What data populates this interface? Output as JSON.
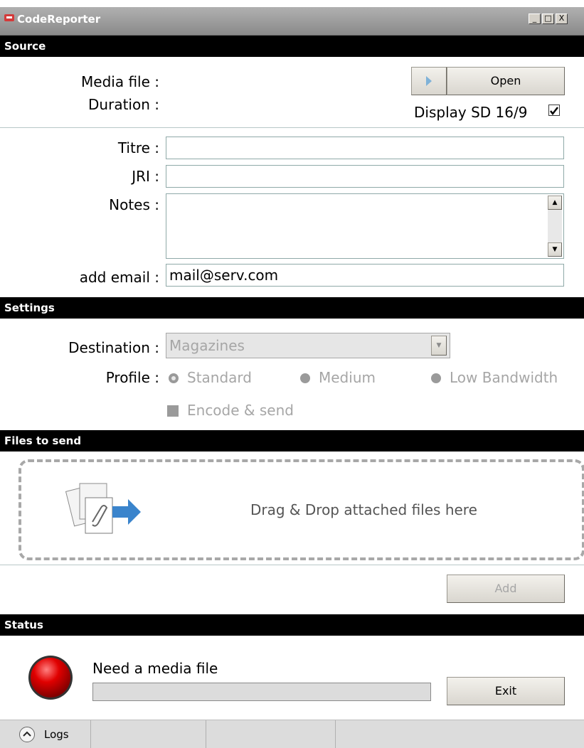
{
  "window": {
    "title": "CodeReporter",
    "minimize": "_",
    "maximize": "□",
    "close": "X"
  },
  "source": {
    "header": "Source",
    "media_file_label": "Media file :",
    "duration_label": "Duration :",
    "open_button": "Open",
    "display_sd_label": "Display SD 16/9",
    "display_sd_checked": true,
    "titre_label": "Titre :",
    "titre_value": "",
    "jri_label": "JRI :",
    "jri_value": "",
    "notes_label": "Notes :",
    "notes_value": "",
    "email_label": "add email :",
    "email_value": "mail@serv.com"
  },
  "settings": {
    "header": "Settings",
    "destination_label": "Destination :",
    "destination_value": "Magazines",
    "profile_label": "Profile :",
    "profiles": [
      "Standard",
      "Medium",
      "Low Bandwidth"
    ],
    "profile_selected": "Standard",
    "encode_label": "Encode & send",
    "encode_checked": false
  },
  "files": {
    "header": "Files to send",
    "drop_text": "Drag & Drop attached files here",
    "add_button": "Add"
  },
  "status": {
    "header": "Status",
    "message": "Need a media file",
    "progress": 0,
    "indicator_color": "#e00000",
    "exit_button": "Exit"
  },
  "statusbar": {
    "logs_label": "Logs"
  }
}
